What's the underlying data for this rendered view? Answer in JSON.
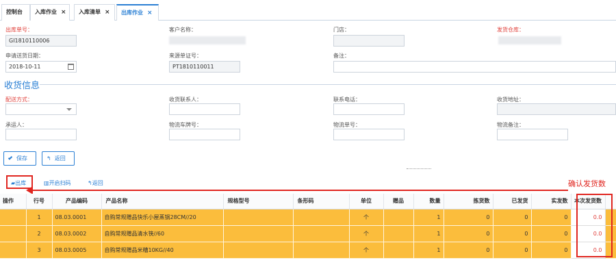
{
  "tabs": [
    {
      "label": "控制台"
    },
    {
      "label": "入库作业",
      "close": "×"
    },
    {
      "label": "入库清单",
      "close": "×"
    },
    {
      "label": "出库作业",
      "close": "×"
    }
  ],
  "form": {
    "out_no_label": "出库单号：",
    "out_no_value": "GI1810110006",
    "customer_label": "客户名称：",
    "store_label": "门店：",
    "warehouse_label": "发货仓库：",
    "apply_date_label": "申请送货日期：",
    "apply_date_value": "2018-10-11",
    "source_no_label": "来源单证号：",
    "source_no_value": "PT1810110011",
    "remark_label": "备注："
  },
  "receipt": {
    "title": "收货信息",
    "delivery_label": "配送方式：",
    "contact_label": "收货联系人：",
    "phone_label": "联系电话：",
    "address_label": "收货地址：",
    "carrier_label": "承运人：",
    "plate_label": "物流车牌号：",
    "logistics_no_label": "物流单号：",
    "logistics_remark_label": "物流备注："
  },
  "actions": {
    "save": "保存",
    "back": "返回"
  },
  "toolbar": {
    "out": "出库",
    "scan": "开启扫码",
    "back": "返回"
  },
  "annotation": "确认发货数",
  "table": {
    "headers": [
      "操作",
      "行号",
      "产品编码",
      "产品名称",
      "规格型号",
      "条形码",
      "单位",
      "赠品",
      "数量",
      "拣货数",
      "已发货",
      "实发数",
      "本次发货数"
    ],
    "rows": [
      [
        "",
        "1",
        "08.03.0001",
        "自购常规赠品快乐小屋蒸锅28CM//20",
        "",
        "",
        "个",
        "",
        "1",
        "0",
        "0",
        "0",
        "0.0"
      ],
      [
        "",
        "2",
        "08.03.0002",
        "自购常规赠品清水筷//60",
        "",
        "",
        "个",
        "",
        "1",
        "0",
        "0",
        "0",
        "0.0"
      ],
      [
        "",
        "3",
        "08.03.0005",
        "自购常规赠品米糟10KG//40",
        "",
        "",
        "个",
        "",
        "1",
        "0",
        "0",
        "0",
        "0.0"
      ]
    ]
  },
  "colors": {
    "accent": "#2a7fd4",
    "row_highlight": "#fbbd3c",
    "annotation": "#e0251f"
  },
  "icons": {
    "close": "×",
    "calendar": "calendar-icon",
    "check": "check-icon",
    "undo": "undo-icon"
  }
}
